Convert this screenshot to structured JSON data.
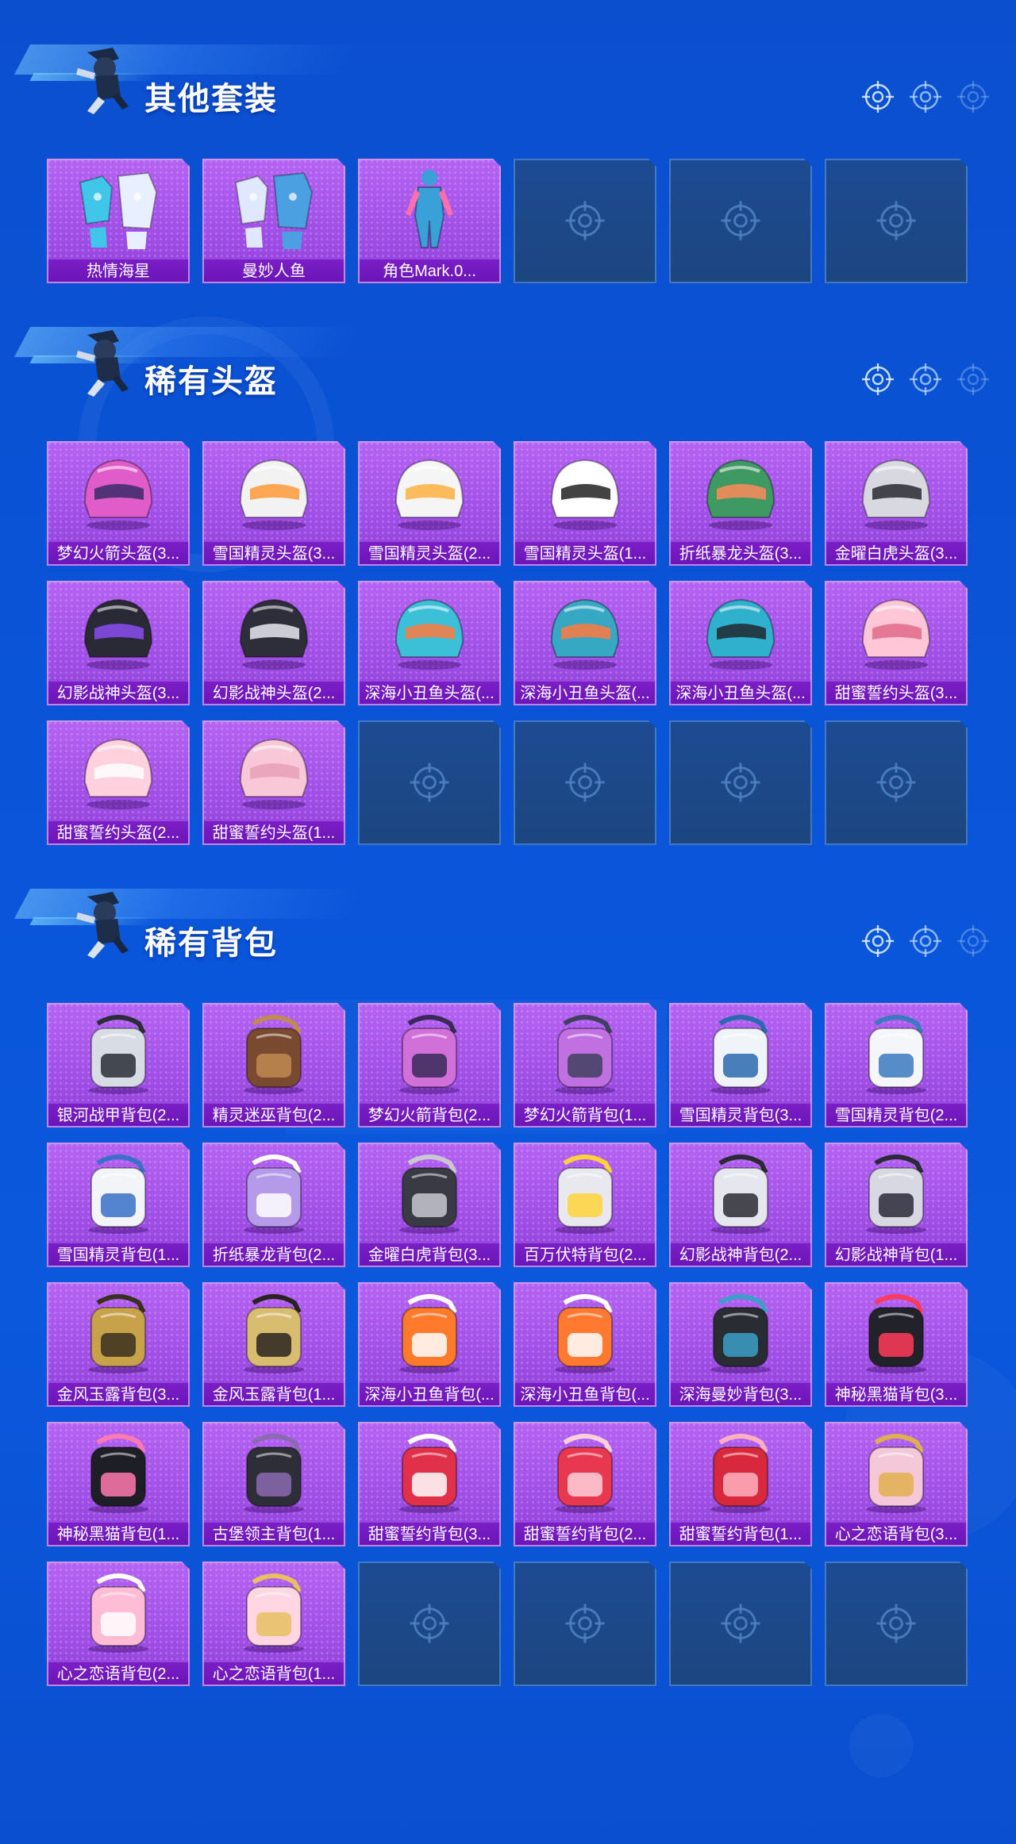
{
  "sections": [
    {
      "title": "其他套装",
      "items": [
        {
          "label": "热情海星",
          "icon": "outfit-icon",
          "accent": "#3fc6e8",
          "accent2": "#e8f0ff"
        },
        {
          "label": "曼妙人鱼",
          "icon": "outfit-icon",
          "accent": "#dfe8ff",
          "accent2": "#4aa0e0"
        },
        {
          "label": "角色Mark.0...",
          "icon": "character-icon",
          "accent": "#3aa0d8",
          "accent2": "#ff6fae"
        }
      ],
      "empty_slots": 3
    },
    {
      "title": "稀有头盔",
      "items": [
        {
          "label": "梦幻火箭头盔(3...",
          "icon": "helmet-icon",
          "accent": "#e05cc8",
          "accent2": "#3a2a6a"
        },
        {
          "label": "雪国精灵头盔(3...",
          "icon": "helmet-icon",
          "accent": "#f2f2f2",
          "accent2": "#ff9a3a"
        },
        {
          "label": "雪国精灵头盔(2...",
          "icon": "helmet-icon",
          "accent": "#f5f5f5",
          "accent2": "#ffb040"
        },
        {
          "label": "雪国精灵头盔(1...",
          "icon": "helmet-icon",
          "accent": "#ffffff",
          "accent2": "#222222"
        },
        {
          "label": "折纸暴龙头盔(3...",
          "icon": "helmet-icon",
          "accent": "#3e9a62",
          "accent2": "#ff8a5a"
        },
        {
          "label": "金曜白虎头盔(3...",
          "icon": "helmet-icon",
          "accent": "#d8d8e0",
          "accent2": "#2a2a30"
        },
        {
          "label": "幻影战神头盔(3...",
          "icon": "helmet-icon",
          "accent": "#2a2a36",
          "accent2": "#8a4cf0"
        },
        {
          "label": "幻影战神头盔(2...",
          "icon": "helmet-icon",
          "accent": "#2e2e3a",
          "accent2": "#e8e8f0"
        },
        {
          "label": "深海小丑鱼头盔(...",
          "icon": "helmet-icon",
          "accent": "#3cc0d8",
          "accent2": "#ff7a40"
        },
        {
          "label": "深海小丑鱼头盔(...",
          "icon": "helmet-icon",
          "accent": "#36a8c4",
          "accent2": "#ff7a40"
        },
        {
          "label": "深海小丑鱼头盔(...",
          "icon": "helmet-icon",
          "accent": "#2fb0cc",
          "accent2": "#202830"
        },
        {
          "label": "甜蜜誓约头盔(3...",
          "icon": "helmet-icon",
          "accent": "#ffc6d8",
          "accent2": "#e06a8a"
        },
        {
          "label": "甜蜜誓约头盔(2...",
          "icon": "helmet-icon",
          "accent": "#ffd0de",
          "accent2": "#ffffff"
        },
        {
          "label": "甜蜜誓约头盔(1...",
          "icon": "helmet-icon",
          "accent": "#f8c8d8",
          "accent2": "#e8a0b8"
        }
      ],
      "empty_slots": 4
    },
    {
      "title": "稀有背包",
      "items": [
        {
          "label": "银河战甲背包(2...",
          "icon": "backpack-icon",
          "accent": "#d8dce4",
          "accent2": "#2a2e36"
        },
        {
          "label": "精灵迷巫背包(2...",
          "icon": "backpack-icon",
          "accent": "#7a4a30",
          "accent2": "#c08a50"
        },
        {
          "label": "梦幻火箭背包(2...",
          "icon": "backpack-icon",
          "accent": "#d070d8",
          "accent2": "#3a2a5a"
        },
        {
          "label": "梦幻火箭背包(1...",
          "icon": "backpack-icon",
          "accent": "#c070e0",
          "accent2": "#404060"
        },
        {
          "label": "雪国精灵背包(3...",
          "icon": "backpack-icon",
          "accent": "#f0f4f8",
          "accent2": "#2a6ab0"
        },
        {
          "label": "雪国精灵背包(2...",
          "icon": "backpack-icon",
          "accent": "#f4f6fa",
          "accent2": "#3a7ac0"
        },
        {
          "label": "雪国精灵背包(1...",
          "icon": "backpack-icon",
          "accent": "#f2f4f8",
          "accent2": "#3a70c8"
        },
        {
          "label": "折纸暴龙背包(2...",
          "icon": "backpack-icon",
          "accent": "#b49ae8",
          "accent2": "#ffffff"
        },
        {
          "label": "金曜白虎背包(3...",
          "icon": "backpack-icon",
          "accent": "#3a3a44",
          "accent2": "#c8c8d0"
        },
        {
          "label": "百万伏特背包(2...",
          "icon": "backpack-icon",
          "accent": "#e8e8ee",
          "accent2": "#ffd23a"
        },
        {
          "label": "幻影战神背包(2...",
          "icon": "backpack-icon",
          "accent": "#e6e6ee",
          "accent2": "#2a2a34"
        },
        {
          "label": "幻影战神背包(1...",
          "icon": "backpack-icon",
          "accent": "#d8d8e2",
          "accent2": "#2a2a38"
        },
        {
          "label": "金风玉露背包(3...",
          "icon": "backpack-icon",
          "accent": "#c8a24a",
          "accent2": "#3a3020"
        },
        {
          "label": "金风玉露背包(1...",
          "icon": "backpack-icon",
          "accent": "#d8bc70",
          "accent2": "#2a2420"
        },
        {
          "label": "深海小丑鱼背包(...",
          "icon": "backpack-icon",
          "accent": "#ff7a2a",
          "accent2": "#ffffff"
        },
        {
          "label": "深海小丑鱼背包(...",
          "icon": "backpack-icon",
          "accent": "#ff7a30",
          "accent2": "#ffffff"
        },
        {
          "label": "深海曼妙背包(3...",
          "icon": "backpack-icon",
          "accent": "#2a2c34",
          "accent2": "#3aa0c8"
        },
        {
          "label": "神秘黑猫背包(3...",
          "icon": "backpack-icon",
          "accent": "#22222a",
          "accent2": "#ff3a5a"
        },
        {
          "label": "神秘黑猫背包(1...",
          "icon": "backpack-icon",
          "accent": "#1e1e26",
          "accent2": "#ff7ab0"
        },
        {
          "label": "古堡领主背包(1...",
          "icon": "backpack-icon",
          "accent": "#2e2e38",
          "accent2": "#8a6ab0"
        },
        {
          "label": "甜蜜誓约背包(3...",
          "icon": "backpack-icon",
          "accent": "#e0304a",
          "accent2": "#ffffff"
        },
        {
          "label": "甜蜜誓约背包(2...",
          "icon": "backpack-icon",
          "accent": "#e83850",
          "accent2": "#ffd0da"
        },
        {
          "label": "甜蜜誓约背包(1...",
          "icon": "backpack-icon",
          "accent": "#d8283c",
          "accent2": "#ffb0c0"
        },
        {
          "label": "心之恋语背包(3...",
          "icon": "backpack-icon",
          "accent": "#f4c8d8",
          "accent2": "#e0b050"
        },
        {
          "label": "心之恋语背包(2...",
          "icon": "backpack-icon",
          "accent": "#ffbcd4",
          "accent2": "#ffffff"
        },
        {
          "label": "心之恋语背包(1...",
          "icon": "backpack-icon",
          "accent": "#ffd6e2",
          "accent2": "#e8c060"
        }
      ],
      "empty_slots": 4
    }
  ],
  "colors": {
    "background": "#0a54d8",
    "card_filled": "#a655ea",
    "card_label_bar": "#7018bd",
    "card_empty": "#1d4989"
  }
}
